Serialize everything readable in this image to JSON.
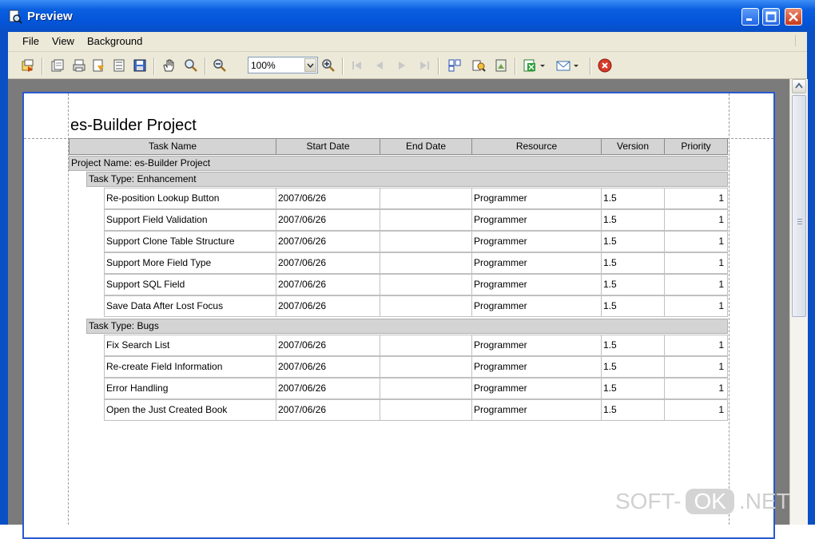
{
  "window": {
    "title": "Preview",
    "titlebar_color": "#0454d8"
  },
  "menubar": {
    "items": [
      {
        "label": "File"
      },
      {
        "label": "View"
      },
      {
        "label": "Background"
      }
    ]
  },
  "toolbar": {
    "zoom_value": "100%",
    "icons": [
      "export-icon",
      "open-icon",
      "print-icon",
      "page-setup-icon",
      "page-layout-icon",
      "save-icon",
      "hand-tool-icon",
      "magnifier-icon",
      "zoom-out-icon",
      "zoom-in-icon",
      "first-page-icon",
      "previous-page-icon",
      "next-page-icon",
      "last-page-icon",
      "multi-page-icon",
      "find-icon",
      "background-icon",
      "export-excel-icon",
      "send-mail-icon",
      "close-preview-icon"
    ]
  },
  "report": {
    "title": "es-Builder Project",
    "columns": [
      "Task Name",
      "Start Date",
      "End Date",
      "Resource",
      "Version",
      "Priority"
    ],
    "project_band": "Project Name: es-Builder Project",
    "groups": [
      {
        "band": "Task Type: Enhancement",
        "rows": [
          {
            "task": "Re-position Lookup Button",
            "start": "2007/06/26",
            "end": "",
            "resource": "Programmer",
            "version": "1.5",
            "priority": "1"
          },
          {
            "task": "Support Field Validation",
            "start": "2007/06/26",
            "end": "",
            "resource": "Programmer",
            "version": "1.5",
            "priority": "1"
          },
          {
            "task": "Support Clone Table Structure",
            "start": "2007/06/26",
            "end": "",
            "resource": "Programmer",
            "version": "1.5",
            "priority": "1"
          },
          {
            "task": "Support More Field Type",
            "start": "2007/06/26",
            "end": "",
            "resource": "Programmer",
            "version": "1.5",
            "priority": "1"
          },
          {
            "task": "Support SQL Field",
            "start": "2007/06/26",
            "end": "",
            "resource": "Programmer",
            "version": "1.5",
            "priority": "1"
          },
          {
            "task": "Save Data After Lost Focus",
            "start": "2007/06/26",
            "end": "",
            "resource": "Programmer",
            "version": "1.5",
            "priority": "1"
          }
        ]
      },
      {
        "band": "Task Type: Bugs",
        "rows": [
          {
            "task": "Fix Search List",
            "start": "2007/06/26",
            "end": "",
            "resource": "Programmer",
            "version": "1.5",
            "priority": "1"
          },
          {
            "task": "Re-create Field Information",
            "start": "2007/06/26",
            "end": "",
            "resource": "Programmer",
            "version": "1.5",
            "priority": "1"
          },
          {
            "task": "Error Handling",
            "start": "2007/06/26",
            "end": "",
            "resource": "Programmer",
            "version": "1.5",
            "priority": "1"
          },
          {
            "task": "Open the Just Created Book",
            "start": "2007/06/26",
            "end": "",
            "resource": "Programmer",
            "version": "1.5",
            "priority": "1"
          }
        ]
      }
    ]
  },
  "watermark": {
    "prefix": "SOFT-",
    "ok": "OK",
    "suffix": ".NET"
  }
}
